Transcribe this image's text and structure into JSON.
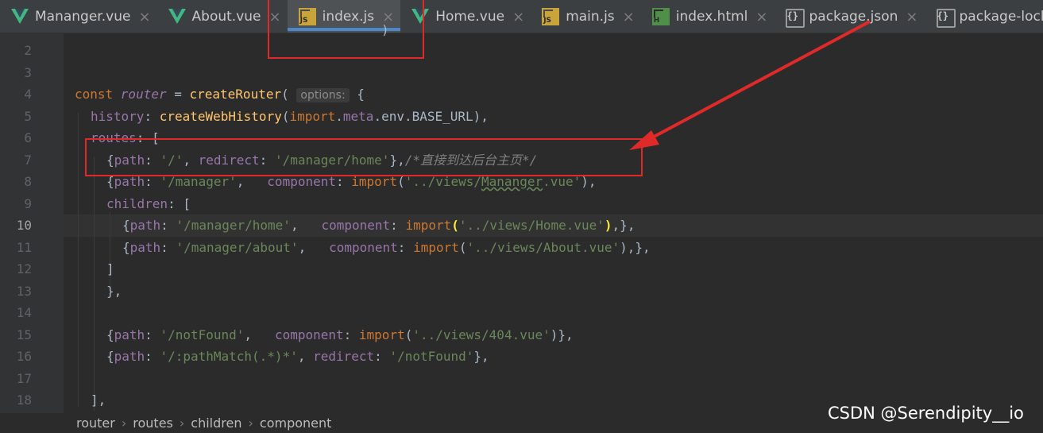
{
  "tabs": [
    {
      "label": "Mananger.vue",
      "icon": "vue-file-icon",
      "active": false
    },
    {
      "label": "About.vue",
      "icon": "vue-file-icon",
      "active": false
    },
    {
      "label": "index.js",
      "icon": "js-file-icon",
      "active": true
    },
    {
      "label": "Home.vue",
      "icon": "vue-file-icon",
      "active": false
    },
    {
      "label": "main.js",
      "icon": "js-file-icon",
      "active": false
    },
    {
      "label": "index.html",
      "icon": "html-file-icon",
      "active": false
    },
    {
      "label": "package.json",
      "icon": "json-file-icon",
      "active": false
    },
    {
      "label": "package-lock.json",
      "icon": "json-file-icon",
      "active": false
    }
  ],
  "icons": {
    "close": "×",
    "js_badge": "JS",
    "html_badge": "H",
    "json_badge": "{}",
    "crumb_separator": "›"
  },
  "gutter": {
    "line_numbers": [
      "2",
      "3",
      "4",
      "5",
      "6",
      "7",
      "8",
      "9",
      "10",
      "11",
      "12",
      "13",
      "14",
      "15",
      "16",
      "17",
      "18"
    ],
    "current_line": "10"
  },
  "code": {
    "l1_frag": ")",
    "l4": {
      "const": "const ",
      "router": "router",
      "eq": " = ",
      "fn": "createRouter",
      "open": "(",
      "hint": "options:",
      "brace": " {"
    },
    "l5": {
      "key": "history",
      "colon": ": ",
      "fn": "createWebHistory",
      "open": "(",
      "kw": "import",
      "dot": ".",
      "prop": "meta",
      "rest": ".env.BASE_URL),"
    },
    "l6": {
      "key": "routes",
      "rest": ": ["
    },
    "l7": {
      "open": "{",
      "key1": "path",
      "c1": ": ",
      "v1": "'/'",
      "sep": ", ",
      "key2": "redirect",
      "c2": ": ",
      "v2": "'/manager/home'",
      "close": "},",
      "comment": "/*直接到达后台主页*/"
    },
    "l8": {
      "open": "{",
      "key1": "path",
      "c1": ": ",
      "v1": "'/manager'",
      "sep": ",   ",
      "key2": "component",
      "c2": ": ",
      "kw": "import",
      "p1": "(",
      "v2a": "'../views/",
      "v2b": "Mananger",
      "v2c": ".vue'",
      "close": "),"
    },
    "l9": {
      "key": "children",
      "rest": ": ["
    },
    "l10": {
      "open": "{",
      "key1": "path",
      "c1": ": ",
      "v1": "'/manager/home'",
      "sep": ",   ",
      "key2": "component",
      "c2": ": ",
      "kw": "import",
      "p1": "(",
      "v2": "'../views/Home.vue'",
      "p2": ")",
      "close": ",},"
    },
    "l11": {
      "open": "{",
      "key1": "path",
      "c1": ": ",
      "v1": "'/manager/about'",
      "sep": ",   ",
      "key2": "component",
      "c2": ": ",
      "kw": "import",
      "p1": "(",
      "v2": "'../views/About.vue'",
      "close": "),},"
    },
    "l12": "]",
    "l13": "},",
    "l15": {
      "open": "{",
      "key1": "path",
      "c1": ": ",
      "v1": "'/notFound'",
      "sep": ",   ",
      "key2": "component",
      "c2": ": ",
      "kw": "import",
      "p1": "(",
      "v2": "'../views/404.vue'",
      "close": ")},"
    },
    "l16": {
      "open": "{",
      "key1": "path",
      "c1": ": ",
      "v1": "'/:pathMatch(.*)*'",
      "sep": ", ",
      "key2": "redirect",
      "c2": ": ",
      "v2": "'/notFound'",
      "close": "},"
    },
    "l18": "],"
  },
  "breadcrumb": [
    "router",
    "routes",
    "children",
    "component"
  ],
  "watermark": "CSDN @Serendipity__io",
  "annotation_color": "#e02a2a"
}
